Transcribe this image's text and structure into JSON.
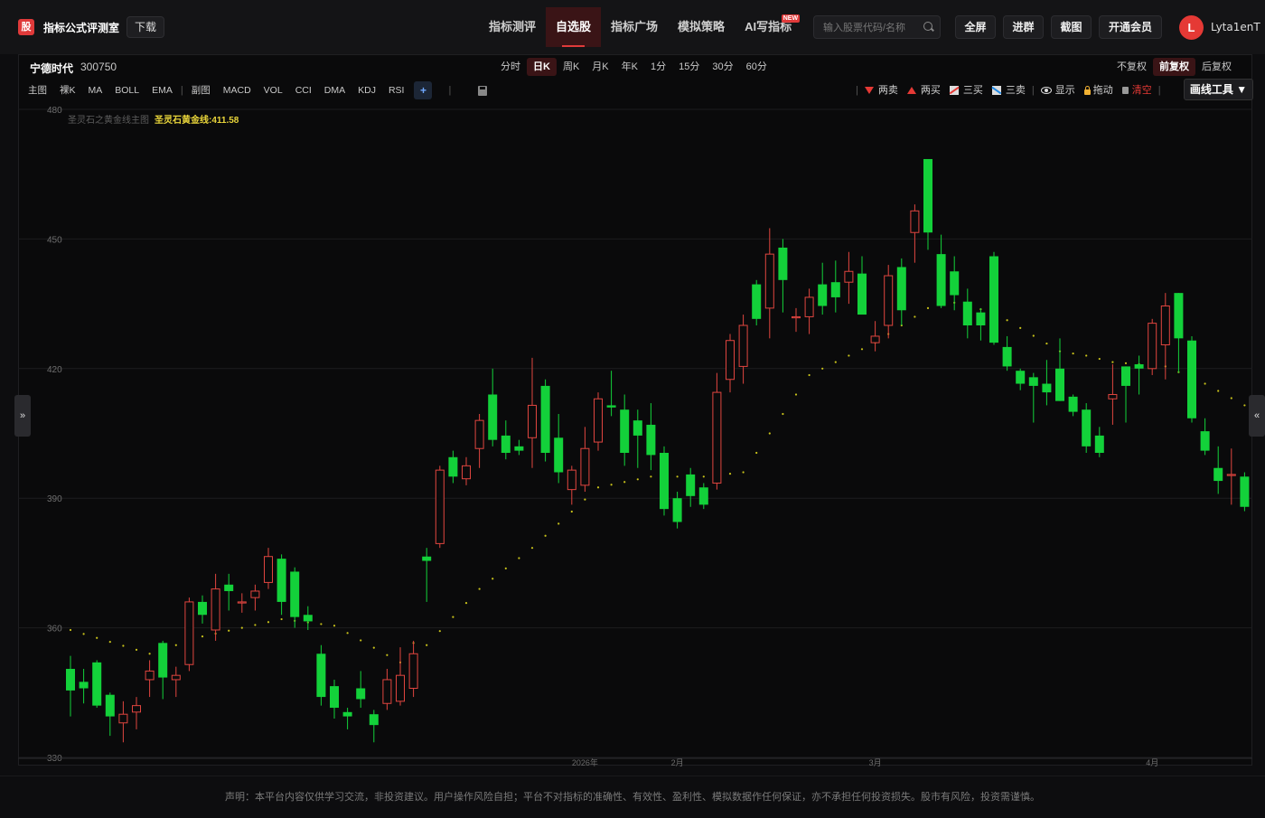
{
  "brand": {
    "logo": "股",
    "name": "指标公式评测室",
    "download": "下载"
  },
  "nav": [
    {
      "label": "指标测评",
      "active": false
    },
    {
      "label": "自选股",
      "active": true
    },
    {
      "label": "指标广场",
      "active": false
    },
    {
      "label": "模拟策略",
      "active": false
    },
    {
      "label": "AI写指标",
      "active": false,
      "badge": "NEW"
    }
  ],
  "search": {
    "placeholder": "输入股票代码/名称",
    "value": ""
  },
  "topbar_buttons": {
    "fullscreen": "全屏",
    "join_group": "进群",
    "screenshot": "截图",
    "vip": "开通会员"
  },
  "user": {
    "initial": "L",
    "name": "Lyta1enT",
    "avatar_color": "#e53935"
  },
  "stock": {
    "name": "宁德时代",
    "code": "300750"
  },
  "periods": [
    {
      "label": "分时",
      "active": false
    },
    {
      "label": "日K",
      "active": true
    },
    {
      "label": "周K",
      "active": false
    },
    {
      "label": "月K",
      "active": false
    },
    {
      "label": "年K",
      "active": false
    },
    {
      "label": "1分",
      "active": false
    },
    {
      "label": "15分",
      "active": false
    },
    {
      "label": "30分",
      "active": false
    },
    {
      "label": "60分",
      "active": false
    }
  ],
  "adjust": [
    {
      "label": "不复权",
      "active": false
    },
    {
      "label": "前复权",
      "active": true
    },
    {
      "label": "后复权",
      "active": false
    }
  ],
  "indicators": {
    "main_label": "主图",
    "naked_k": "裸K",
    "ma": "MA",
    "boll": "BOLL",
    "ema": "EMA",
    "sub_label": "副图",
    "macd": "MACD",
    "vol": "VOL",
    "cci": "CCI",
    "dma": "DMA",
    "kdj": "KDJ",
    "rsi": "RSI",
    "add": "+"
  },
  "tools": {
    "two_sell": "两卖",
    "two_buy": "两买",
    "three_buy": "三买",
    "three_sell": "三卖",
    "show": "显示",
    "drag": "拖动",
    "clear": "清空",
    "draw_tools": "画线工具 ▼"
  },
  "side_tabs": {
    "left": "»",
    "right": "«"
  },
  "legend": {
    "main_name": "圣灵石之黄金线主图",
    "series_label": "圣灵石黄金线:411.58"
  },
  "colors": {
    "up": "#e0453f",
    "down": "#13d13a",
    "accent": "#e03a3a",
    "gold_line": "#c8c21a"
  },
  "chart_data": {
    "type": "candlestick",
    "ylim": [
      330,
      480
    ],
    "y_ticks": [
      "480",
      "450",
      "420",
      "390",
      "360",
      "330"
    ],
    "x_ticks": [
      {
        "label": "2026年",
        "index": 39
      },
      {
        "label": "2月",
        "index": 46
      },
      {
        "label": "3月",
        "index": 61
      },
      {
        "label": "4月",
        "index": 82
      }
    ],
    "candles": [
      [
        350.5,
        345.5,
        353.5,
        339.5
      ],
      [
        347.5,
        346.0,
        350.5,
        342.5
      ],
      [
        352.0,
        342.0,
        352.5,
        341.5
      ],
      [
        344.5,
        339.5,
        345.0,
        335.0
      ],
      [
        338.0,
        340.0,
        343.0,
        333.5
      ],
      [
        340.5,
        342.0,
        344.0,
        336.5
      ],
      [
        348.0,
        350.0,
        352.5,
        344.0
      ],
      [
        356.5,
        348.5,
        357.0,
        343.5
      ],
      [
        348.0,
        349.0,
        351.0,
        344.0
      ],
      [
        351.5,
        366.0,
        367.0,
        350.0
      ],
      [
        366.0,
        363.0,
        367.5,
        361.0
      ],
      [
        359.5,
        369.0,
        372.5,
        357.0
      ],
      [
        370.0,
        368.5,
        372.5,
        364.0
      ],
      [
        366.0,
        366.0,
        368.0,
        363.5
      ],
      [
        367.0,
        368.5,
        370.0,
        364.0
      ],
      [
        370.5,
        376.5,
        378.5,
        369.0
      ],
      [
        376.0,
        366.0,
        377.0,
        363.0
      ],
      [
        373.0,
        362.5,
        374.0,
        360.0
      ],
      [
        363.0,
        361.5,
        365.0,
        359.5
      ],
      [
        354.0,
        344.0,
        356.0,
        342.0
      ],
      [
        346.5,
        341.5,
        348.0,
        339.0
      ],
      [
        340.5,
        339.5,
        341.5,
        336.5
      ],
      [
        346.0,
        343.5,
        350.0,
        341.5
      ],
      [
        340.0,
        337.5,
        341.0,
        333.5
      ],
      [
        342.5,
        348.0,
        350.5,
        341.0
      ],
      [
        343.0,
        349.0,
        355.5,
        342.0
      ],
      [
        346.0,
        354.0,
        357.0,
        344.0
      ],
      [
        376.5,
        375.5,
        378.5,
        366.0
      ],
      [
        379.5,
        396.5,
        397.5,
        378.5
      ],
      [
        399.5,
        395.0,
        401.0,
        393.5
      ],
      [
        394.5,
        397.5,
        399.5,
        393.0
      ],
      [
        401.5,
        408.0,
        409.5,
        397.0
      ],
      [
        414.0,
        403.5,
        420.0,
        402.0
      ],
      [
        404.5,
        400.5,
        408.0,
        399.0
      ],
      [
        402.0,
        401.0,
        403.5,
        400.0
      ],
      [
        404.0,
        411.5,
        422.5,
        397.0
      ],
      [
        416.0,
        400.5,
        417.5,
        398.5
      ],
      [
        404.0,
        396.0,
        409.5,
        393.5
      ],
      [
        392.0,
        396.5,
        397.5,
        388.5
      ],
      [
        393.0,
        401.5,
        406.5,
        391.5
      ],
      [
        403.0,
        413.0,
        414.5,
        401.0
      ],
      [
        411.5,
        411.0,
        419.5,
        409.0
      ],
      [
        410.5,
        400.5,
        414.0,
        397.5
      ],
      [
        408.0,
        404.5,
        410.5,
        397.0
      ],
      [
        407.0,
        400.0,
        412.0,
        396.5
      ],
      [
        400.5,
        387.5,
        402.0,
        386.0
      ],
      [
        390.0,
        384.5,
        391.5,
        383.0
      ],
      [
        395.5,
        390.5,
        397.0,
        388.0
      ],
      [
        392.5,
        388.5,
        393.5,
        387.5
      ],
      [
        393.5,
        414.5,
        419.0,
        392.0
      ],
      [
        417.5,
        426.5,
        428.0,
        414.5
      ],
      [
        420.5,
        430.0,
        432.5,
        416.5
      ],
      [
        439.5,
        431.5,
        440.5,
        430.0
      ],
      [
        434.0,
        446.5,
        452.5,
        427.0
      ],
      [
        448.0,
        440.5,
        450.0,
        433.0
      ],
      [
        432.0,
        432.0,
        434.0,
        428.5
      ],
      [
        432.0,
        436.5,
        438.5,
        428.0
      ],
      [
        439.5,
        434.5,
        444.5,
        432.5
      ],
      [
        440.0,
        436.5,
        445.0,
        433.0
      ],
      [
        440.0,
        442.5,
        447.0,
        435.0
      ],
      [
        442.0,
        432.5,
        446.0,
        432.5
      ],
      [
        426.0,
        427.5,
        431.0,
        424.0
      ],
      [
        430.0,
        441.5,
        444.0,
        427.0
      ],
      [
        443.5,
        433.5,
        445.5,
        430.0
      ],
      [
        451.5,
        456.5,
        458.0,
        444.5
      ],
      [
        468.5,
        451.5,
        468.5,
        447.5
      ],
      [
        446.5,
        434.5,
        451.0,
        434.0
      ],
      [
        442.5,
        437.0,
        446.0,
        433.5
      ],
      [
        435.5,
        430.0,
        438.5,
        427.0
      ],
      [
        433.0,
        430.0,
        434.0,
        426.5
      ],
      [
        446.0,
        426.0,
        447.0,
        425.5
      ],
      [
        425.0,
        420.5,
        427.5,
        419.5
      ],
      [
        419.5,
        416.5,
        420.0,
        415.0
      ],
      [
        418.0,
        416.0,
        419.0,
        407.5
      ],
      [
        416.5,
        414.5,
        422.0,
        411.5
      ],
      [
        420.0,
        412.5,
        427.0,
        412.5
      ],
      [
        413.5,
        410.0,
        414.0,
        409.0
      ],
      [
        410.5,
        402.0,
        412.0,
        400.5
      ],
      [
        404.5,
        400.5,
        406.5,
        399.5
      ],
      [
        413.0,
        414.0,
        421.0,
        407.0
      ],
      [
        420.5,
        416.0,
        420.5,
        407.5
      ],
      [
        421.0,
        420.0,
        423.0,
        414.0
      ],
      [
        420.0,
        430.5,
        431.5,
        418.5
      ],
      [
        425.5,
        434.5,
        437.5,
        417.5
      ],
      [
        437.5,
        427.0,
        437.5,
        419.0
      ],
      [
        426.5,
        408.5,
        427.5,
        407.5
      ],
      [
        405.5,
        401.0,
        408.5,
        400.0
      ],
      [
        397.0,
        394.0,
        402.0,
        391.0
      ],
      [
        395.5,
        395.5,
        401.5,
        388.5
      ],
      [
        395.0,
        388.0,
        396.0,
        387.0
      ]
    ],
    "gold_line": [
      [
        0,
        359.5
      ],
      [
        6,
        354.0
      ],
      [
        10,
        358.0
      ],
      [
        16,
        362.0
      ],
      [
        20,
        360.5
      ],
      [
        25,
        352.0
      ],
      [
        26,
        356.5
      ],
      [
        27,
        356.0
      ],
      [
        31,
        369.0
      ],
      [
        35,
        378.5
      ],
      [
        40,
        392.5
      ],
      [
        44,
        395.0
      ],
      [
        48,
        395.0
      ],
      [
        51,
        396.0
      ],
      [
        56,
        418.5
      ],
      [
        61,
        426.0
      ],
      [
        63,
        430.0
      ],
      [
        66,
        436.0
      ],
      [
        70,
        433.0
      ],
      [
        75,
        424.0
      ],
      [
        77,
        423.0
      ],
      [
        79,
        421.5
      ],
      [
        83,
        420.5
      ],
      [
        86,
        416.5
      ],
      [
        89,
        411.5
      ]
    ]
  },
  "disclaimer": "声明：本平台内容仅供学习交流，非投资建议。用户操作风险自担；平台不对指标的准确性、有效性、盈利性、模拟数据作任何保证，亦不承担任何投资损失。股市有风险，投资需谨慎。"
}
